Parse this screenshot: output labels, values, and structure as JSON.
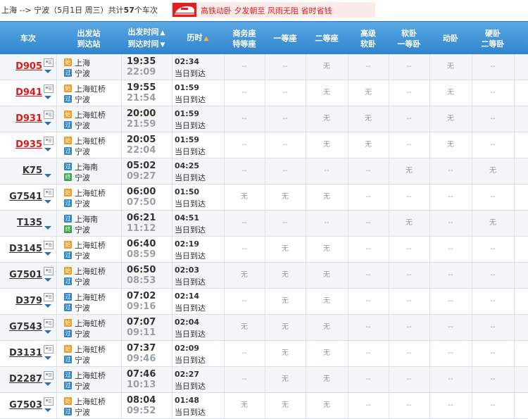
{
  "header": {
    "route_prefix": "上海 --> 宁波（5月1日  周三）共计",
    "train_count": "57",
    "route_suffix": "个车次",
    "promo_text": "高铁动卧  夕发朝至  风雨无阻  省时省钱",
    "promo_icon": "train-icon"
  },
  "columns": {
    "train": "车次",
    "station_from": "出发站",
    "station_to": "到达站",
    "time_dep": "出发时间",
    "time_arr": "到达时间",
    "duration": "历时",
    "business1": "商务座",
    "business2": "特等座",
    "first": "一等座",
    "second": "二等座",
    "adv_soft1": "高级",
    "adv_soft2": "软卧",
    "soft1": "软卧",
    "soft2": "一等卧",
    "emu_sleeper": "动卧",
    "hard1": "硬卧",
    "hard2": "二等卧"
  },
  "colors": {
    "header_bg": "#2f84cc",
    "red_train": "#e01818",
    "start_badge": "#f29a1f",
    "pass_badge": "#2f86cf",
    "end_badge": "#3aa24a"
  },
  "badges": {
    "start": "始",
    "pass": "过",
    "end": "终"
  },
  "rows": [
    {
      "no": "D905",
      "red": true,
      "doc": true,
      "from": "上海",
      "from_type": "start",
      "to": "宁波",
      "to_type": "pass",
      "dep": "19:35",
      "arr": "22:09",
      "dur": "02:34",
      "note": "当日到达",
      "seats": [
        "--",
        "--",
        "无",
        "--",
        "--",
        "无",
        "--"
      ]
    },
    {
      "no": "D941",
      "red": true,
      "doc": true,
      "from": "上海虹桥",
      "from_type": "start",
      "to": "宁波",
      "to_type": "pass",
      "dep": "19:55",
      "arr": "21:54",
      "dur": "01:59",
      "note": "当日到达",
      "seats": [
        "--",
        "--",
        "无",
        "无",
        "--",
        "无",
        "--"
      ]
    },
    {
      "no": "D931",
      "red": true,
      "doc": true,
      "from": "上海虹桥",
      "from_type": "start",
      "to": "宁波",
      "to_type": "pass",
      "dep": "20:00",
      "arr": "21:59",
      "dur": "01:59",
      "note": "当日到达",
      "seats": [
        "--",
        "--",
        "无",
        "无",
        "--",
        "无",
        "--"
      ]
    },
    {
      "no": "D935",
      "red": true,
      "doc": true,
      "from": "上海虹桥",
      "from_type": "start",
      "to": "宁波",
      "to_type": "pass",
      "dep": "20:05",
      "arr": "22:04",
      "dur": "01:59",
      "note": "当日到达",
      "seats": [
        "--",
        "--",
        "无",
        "无",
        "--",
        "无",
        "--"
      ]
    },
    {
      "no": "K75",
      "red": false,
      "doc": false,
      "from": "上海南",
      "from_type": "pass",
      "to": "宁波",
      "to_type": "end",
      "dep": "05:02",
      "arr": "09:27",
      "dur": "04:25",
      "note": "当日到达",
      "seats": [
        "--",
        "--",
        "--",
        "--",
        "无",
        "--",
        "无"
      ]
    },
    {
      "no": "G7541",
      "red": false,
      "doc": true,
      "from": "上海虹桥",
      "from_type": "start",
      "to": "宁波",
      "to_type": "pass",
      "dep": "06:00",
      "arr": "07:50",
      "dur": "01:50",
      "note": "当日到达",
      "seats": [
        "无",
        "无",
        "无",
        "--",
        "--",
        "--",
        "--"
      ]
    },
    {
      "no": "T135",
      "red": false,
      "doc": false,
      "from": "上海南",
      "from_type": "pass",
      "to": "宁波",
      "to_type": "end",
      "dep": "06:21",
      "arr": "11:12",
      "dur": "04:51",
      "note": "当日到达",
      "seats": [
        "--",
        "--",
        "--",
        "--",
        "无",
        "--",
        "无"
      ]
    },
    {
      "no": "D3145",
      "red": false,
      "doc": true,
      "from": "上海虹桥",
      "from_type": "start",
      "to": "宁波",
      "to_type": "pass",
      "dep": "06:40",
      "arr": "08:59",
      "dur": "02:19",
      "note": "当日到达",
      "seats": [
        "--",
        "无",
        "无",
        "--",
        "--",
        "--",
        "--"
      ]
    },
    {
      "no": "G7501",
      "red": false,
      "doc": true,
      "from": "上海虹桥",
      "from_type": "start",
      "to": "宁波",
      "to_type": "pass",
      "dep": "06:50",
      "arr": "08:53",
      "dur": "02:03",
      "note": "当日到达",
      "seats": [
        "无",
        "无",
        "无",
        "--",
        "--",
        "--",
        "--"
      ]
    },
    {
      "no": "D379",
      "red": false,
      "doc": true,
      "from": "上海虹桥",
      "from_type": "pass",
      "to": "宁波",
      "to_type": "pass",
      "dep": "07:02",
      "arr": "09:16",
      "dur": "02:14",
      "note": "当日到达",
      "seats": [
        "--",
        "无",
        "无",
        "--",
        "--",
        "--",
        "--"
      ]
    },
    {
      "no": "G7543",
      "red": false,
      "doc": true,
      "from": "上海虹桥",
      "from_type": "start",
      "to": "宁波",
      "to_type": "pass",
      "dep": "07:07",
      "arr": "09:11",
      "dur": "02:04",
      "note": "当日到达",
      "seats": [
        "无",
        "无",
        "无",
        "--",
        "--",
        "--",
        "--"
      ]
    },
    {
      "no": "D3131",
      "red": false,
      "doc": true,
      "from": "上海虹桥",
      "from_type": "start",
      "to": "宁波",
      "to_type": "pass",
      "dep": "07:37",
      "arr": "09:46",
      "dur": "02:09",
      "note": "当日到达",
      "seats": [
        "--",
        "无",
        "无",
        "--",
        "--",
        "--",
        "--"
      ]
    },
    {
      "no": "D2287",
      "red": false,
      "doc": true,
      "from": "上海虹桥",
      "from_type": "pass",
      "to": "宁波",
      "to_type": "pass",
      "dep": "07:46",
      "arr": "10:13",
      "dur": "02:27",
      "note": "当日到达",
      "seats": [
        "--",
        "无",
        "无",
        "--",
        "--",
        "--",
        "--"
      ]
    },
    {
      "no": "G7503",
      "red": false,
      "doc": true,
      "from": "上海虹桥",
      "from_type": "start",
      "to": "宁波",
      "to_type": "pass",
      "dep": "08:04",
      "arr": "09:52",
      "dur": "01:48",
      "note": "当日到达",
      "seats": [
        "无",
        "无",
        "无",
        "--",
        "--",
        "--",
        "--"
      ]
    }
  ]
}
